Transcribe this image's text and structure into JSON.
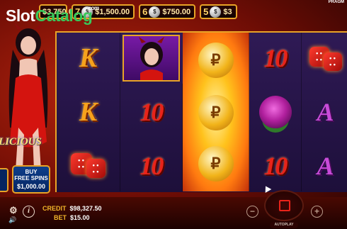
{
  "watermark": {
    "slot": "Slot",
    "catalog": "Catalog",
    "com": ".com"
  },
  "brand_tag": "PRAGM",
  "jackpots": [
    {
      "count": "",
      "ball": "",
      "value": "$3,750.00"
    },
    {
      "count": "7",
      "ball": "$",
      "value": "$1,500.00"
    },
    {
      "count": "6",
      "ball": "$",
      "value": "$750.00"
    },
    {
      "count": "5",
      "ball": "$",
      "value": "$3"
    }
  ],
  "game_logo": "LICIOUS",
  "buy_free_spins": {
    "line1": "BUY",
    "line2": "FREE SPINS",
    "price": "$1,000.00"
  },
  "reels": {
    "row1": {
      "c1": "K",
      "c4": "10"
    },
    "row2": {
      "c1": "K",
      "c2": "10",
      "c5": "A"
    },
    "row3": {
      "c2": "10",
      "c4": "10",
      "c5": "A"
    }
  },
  "credit": {
    "label": "CREDIT",
    "value": "$98,327.50"
  },
  "bet": {
    "label": "BET",
    "value": "$15.00"
  },
  "controls": {
    "minus": "−",
    "plus": "+",
    "autoplay": "AUTOPLAY",
    "gear": "⚙",
    "info": "i",
    "speaker": "🔊"
  },
  "colors": {
    "accent_gold": "#e8a327",
    "credit_label": "#f3b52a",
    "spin_square": "#e8231a"
  }
}
